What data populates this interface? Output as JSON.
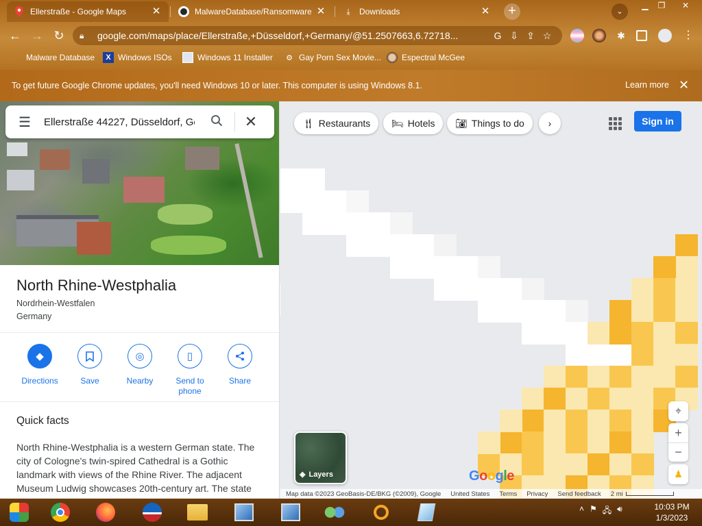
{
  "browser": {
    "tabs": [
      {
        "title": "Ellerstraße - Google Maps",
        "active": true
      },
      {
        "title": "MalwareDatabase/Ransomware a",
        "active": false
      },
      {
        "title": "Downloads",
        "active": false
      }
    ],
    "url": "google.com/maps/place/Ellerstraße,+Düsseldorf,+Germany/@51.2507663,6.72718...",
    "bookmarks": [
      {
        "label": "Malware Database"
      },
      {
        "label": "Windows ISOs"
      },
      {
        "label": "Windows 11 Installer"
      },
      {
        "label": "Gay Porn Sex Movie..."
      },
      {
        "label": "Espectral McGee"
      }
    ]
  },
  "infobar": {
    "message": "To get future Google Chrome updates, you'll need Windows 10 or later. This computer is using Windows 8.1.",
    "learn_more": "Learn more"
  },
  "panel": {
    "search_value": "Ellerstraße 44227, Düsseldorf, Ge",
    "title": "North Rhine-Westphalia",
    "subtitle1": "Nordrhein-Westfalen",
    "subtitle2": "Germany",
    "actions": [
      {
        "label": "Directions",
        "icon": "directions-icon"
      },
      {
        "label": "Save",
        "icon": "bookmark-icon"
      },
      {
        "label": "Nearby",
        "icon": "nearby-icon"
      },
      {
        "label": "Send to phone",
        "icon": "send-to-phone-icon"
      },
      {
        "label": "Share",
        "icon": "share-icon"
      }
    ],
    "quick_facts_title": "Quick facts",
    "quick_facts_body": "North Rhine-Westphalia is a western German state. The city of Cologne's twin-spired Cathedral is a Gothic landmark with views of the Rhine River. The adjacent Museum Ludwig showcases 20th-century art. The state capital, Düsseldorf, is known for its fashion and art scene."
  },
  "map": {
    "chips": [
      {
        "label": "Restaurants",
        "icon": "restaurant-icon"
      },
      {
        "label": "Hotels",
        "icon": "hotel-icon"
      },
      {
        "label": "Things to do",
        "icon": "camera-icon"
      }
    ],
    "sign_in": "Sign in",
    "layers": "Layers",
    "attribution": {
      "data": "Map data ©2023 GeoBasis-DE/BKG (©2009), Google",
      "region": "United States",
      "terms": "Terms",
      "privacy": "Privacy",
      "feedback": "Send feedback",
      "scale": "2 mi"
    },
    "colors": {
      "yellow": "#f9c74f",
      "deep_yellow": "#f5b52e",
      "pale": "#fbe8b0"
    }
  },
  "taskbar": {
    "time": "10:03 PM",
    "date": "1/3/2023"
  }
}
